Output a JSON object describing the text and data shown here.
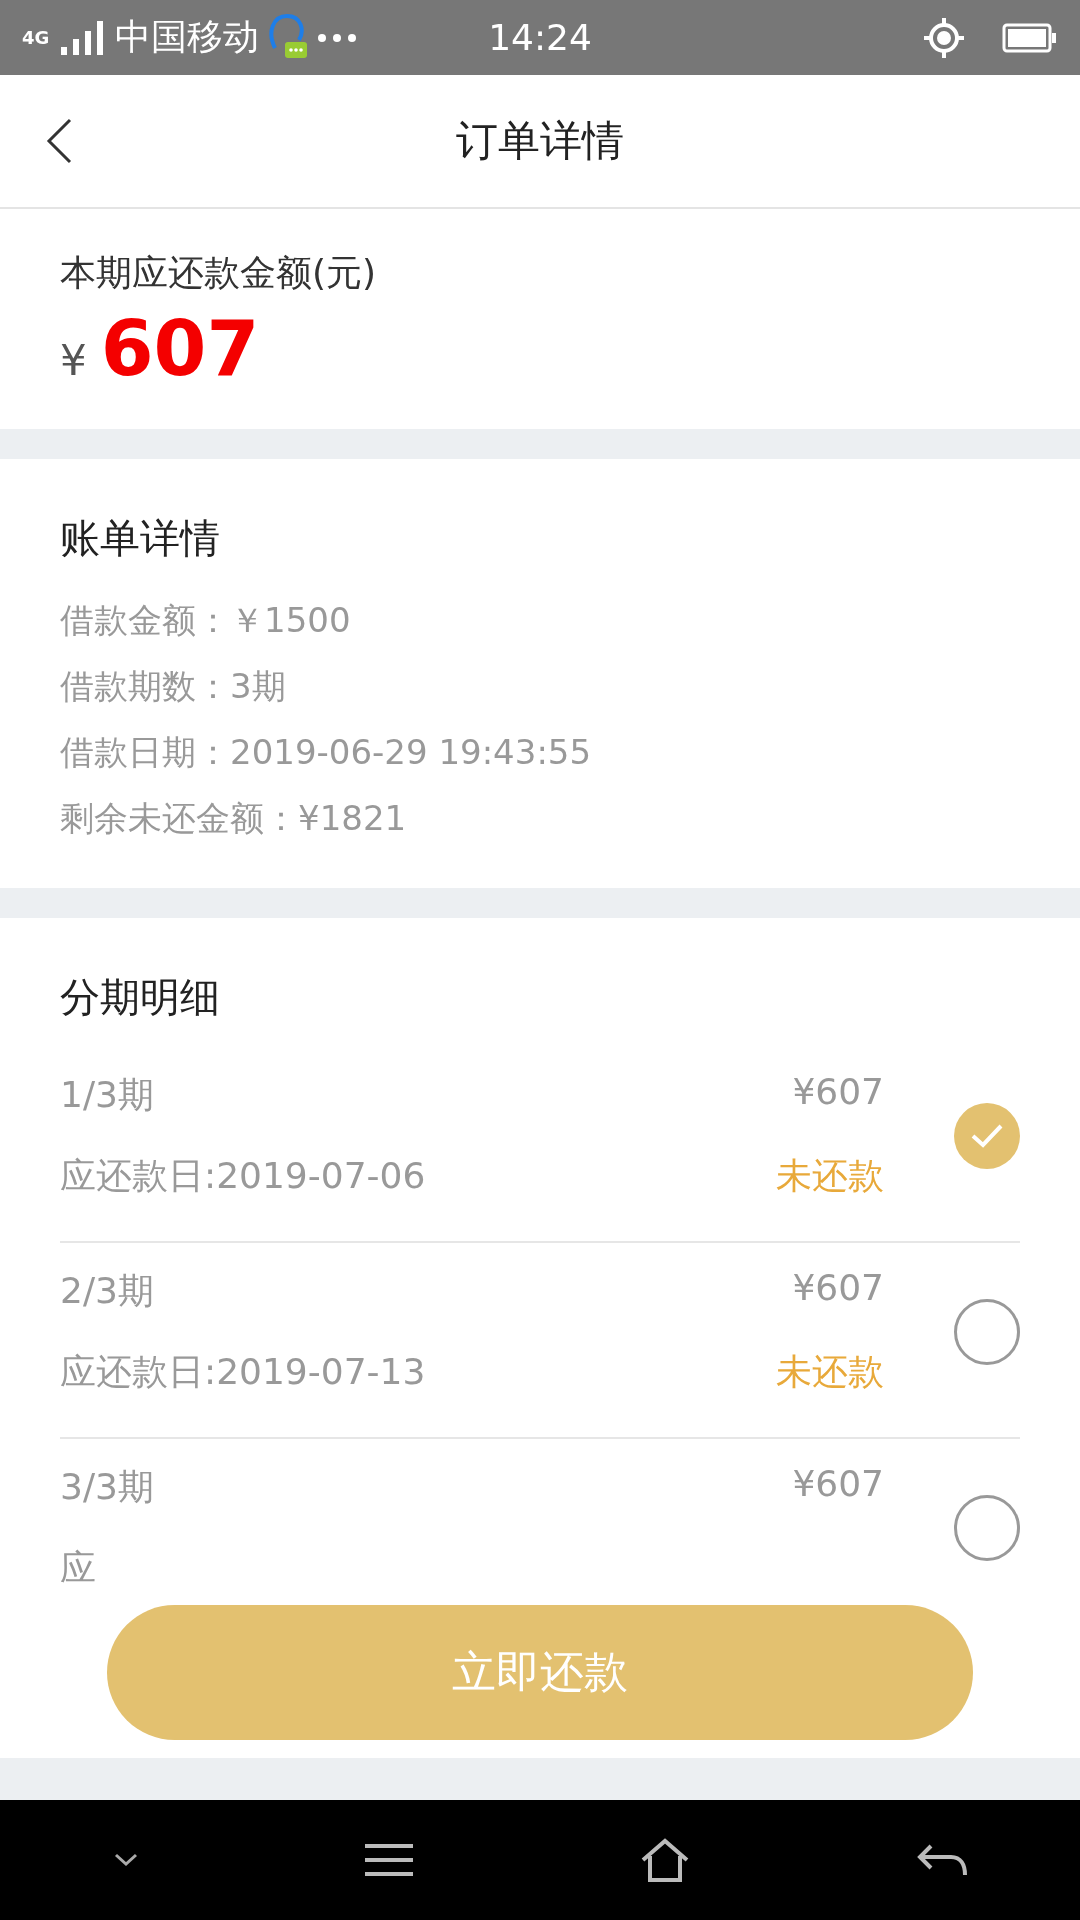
{
  "status_bar": {
    "network": "4G",
    "carrier": "中国移动",
    "time": "14:24"
  },
  "header": {
    "title": "订单详情"
  },
  "due_now": {
    "label": "本期应还款金额(元)",
    "currency": "¥",
    "amount": "607"
  },
  "bill": {
    "title": "账单详情",
    "lines": [
      {
        "text": "借款金额：￥1500"
      },
      {
        "text": "借款期数：3期"
      },
      {
        "text": "借款日期：2019-06-29 19:43:55"
      },
      {
        "text": "剩余未还金额：¥1821"
      }
    ]
  },
  "installments": {
    "title": "分期明细",
    "rows": [
      {
        "period": "1/3期",
        "amount": "¥607",
        "due": "应还款日:2019-07-06",
        "status": "未还款",
        "selected": true
      },
      {
        "period": "2/3期",
        "amount": "¥607",
        "due": "应还款日:2019-07-13",
        "status": "未还款",
        "selected": false
      },
      {
        "period": "3/3期",
        "amount": "¥607",
        "due": "应",
        "selected": false
      }
    ]
  },
  "pay_button": {
    "label": "立即还款"
  }
}
